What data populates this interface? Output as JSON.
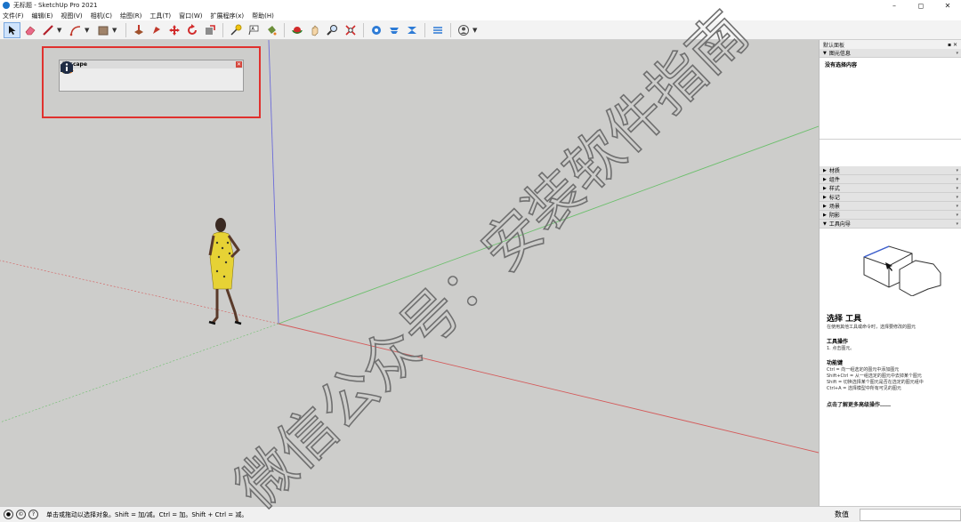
{
  "window": {
    "title": "无标题 - SketchUp Pro 2021",
    "minimize": "–",
    "maximize": "◻",
    "close": "✕"
  },
  "menu": [
    "文件(F)",
    "编辑(E)",
    "视图(V)",
    "相机(C)",
    "绘图(R)",
    "工具(T)",
    "窗口(W)",
    "扩展程序(x)",
    "帮助(H)"
  ],
  "toolbar": {
    "icons": [
      "select-icon",
      "eraser-icon",
      "line-icon",
      "arc-icon",
      "rectangle-icon",
      "push-pull-icon",
      "offset-icon",
      "move-icon",
      "rotate-icon",
      "scale-icon",
      "tape-measure-icon",
      "text-icon",
      "paint-bucket-icon",
      "orbit-icon",
      "pan-icon",
      "zoom-icon",
      "zoom-extents-icon",
      "warehouse-icon",
      "extension-warehouse-icon",
      "layout-icon",
      "send-to-layout-icon",
      "account-icon"
    ]
  },
  "encape": {
    "title": "Enscape",
    "close": "✕"
  },
  "right_panel": {
    "title": "默认面板",
    "entity_info": {
      "label": "图元信息",
      "content": "没有选择内容"
    },
    "collapsed_sections": [
      "材质",
      "组件",
      "样式",
      "标记",
      "场景",
      "阴影"
    ],
    "instructor": {
      "label": "工具向导",
      "tool_title": "选择 工具",
      "tool_subtitle": "在使用其他工具或命令时，选择要修改的图元",
      "ops_heading": "工具操作",
      "ops": [
        "1. 点击图元。"
      ],
      "keys_heading": "功能键",
      "keys": [
        "Ctrl = 向一组选定的图元中添加图元",
        "Shift+Ctrl = 从一组选定的图元中去掉某个图元",
        "Shift = 切换选择某个图元是否在选定的图元组中",
        "Ctrl+A = 选择模型中所有可见的图元"
      ],
      "more_link": "点击了解更多高级操作……"
    }
  },
  "status": {
    "hint": "单击或拖动以选择对象。Shift = 加/减。Ctrl = 加。Shift + Ctrl = 减。",
    "measure_label": "数值"
  },
  "watermark": {
    "text": "微信公众号：安装软件指南"
  },
  "colors": {
    "red_axis": "#d45a5a",
    "green_axis": "#6cbf6c",
    "blue_axis": "#6b6bd9",
    "highlight": "#e0312e",
    "sky": "#ffffff",
    "ground": "#cdcdcb"
  }
}
